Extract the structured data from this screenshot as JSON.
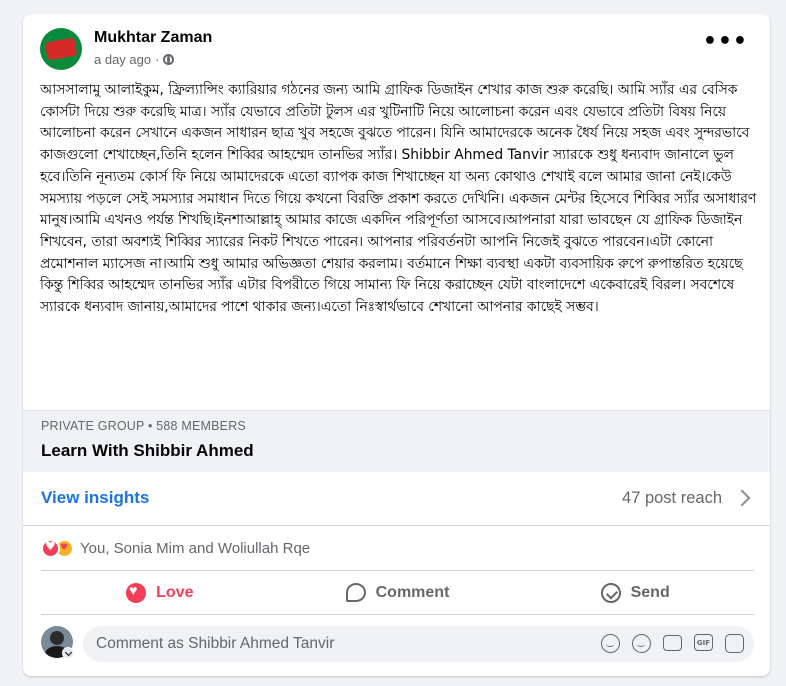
{
  "post": {
    "author": "Mukhtar Zaman",
    "time": "a day ago",
    "more_label": "•••",
    "text": "আসসালামু আলাইকুম, ফ্রিল্যান্সিং ক্যারিয়ার গঠনের জন্য আমি গ্রাফিক ডিজাইন শেখার কাজ শুরু করেছি। আমি স্যাঁর এর বেসিক কোর্সটা দিয়ে শুরু করেছি মাত্র। স্যাঁর যেভাবে প্রতিটা টুলস এর খুটিনাটি নিয়ে আলোচনা করেন এবং যেভাবে প্রতিটা বিষয় নিয়ে আলোচনা করেন সেখানে একজন সাধারন ছাত্র খুব সহজে বুঝতে পারেন। যিনি আমাদেরকে অনেক ধৈর্য নিয়ে সহজ এবং সুন্দরভাবে কাজগুলো শেখাচ্ছেন,তিনি হলেন শিব্বির আহম্মেদ তানভির স্যাঁর। Shibbir Ahmed Tanvir স্যারকে শুধু ধন্যবাদ জানালে ভুল হবে।তিনি নূন্যতম কোর্স ফি নিয়ে আমাদেরকে এতো ব্যাপক কাজ শিখাচ্ছেন যা অন্য কোথাও শেখাই বলে আমার জানা নেই।কেউ সমস্যায় পড়লে সেই সমস্যার সমাধান দিতে গিয়ে কখনো বিরক্তি প্রকাশ করতে দেখিনি। একজন মেন্টর হিসেবে শিব্বির স্যাঁর অসাধারণ মানুষ।আমি এখনও পর্যন্ত শিখছি।ইনশাআল্লাহ্ আমার কাজে একদিন পরিপূর্ণতা আসবে।আপনারা যারা ভাবছেন যে গ্রাফিক ডিজাইন শিখবেন, তারা অবশ্যই শিব্বির স্যারের নিকট শিখতে পারেন। আপনার পরিবর্তনটা আপনি নিজেই বুঝতে পারবেন।এটা কোনো প্রমোশনাল ম্যাসেজ না।আমি শুধু আমার অভিজ্ঞতা শেয়ার করলাম। বর্তমানে শিক্ষা ব্যবস্থা একটা ব্যবসায়িক রুপে রুপান্তরিত হয়েছে কিন্তু শিব্বির আহম্মেদ তানভির স্যাঁর এটার বিপরীতে গিয়ে সামান্য ফি নিয়ে করাচ্ছেন যেটা বাংলাদেশে একেবারেই বিরল। সবশেষে স্যারকে ধন্যবাদ জানায়,আমাদের পাশে থাকার জন্য।এতো নিঃস্বার্থভাবে শেখানো আপনার কাছেই সম্ভব।"
  },
  "group": {
    "meta": "PRIVATE GROUP • 588 MEMBERS",
    "name": "Learn With Shibbir Ahmed"
  },
  "insights": {
    "label": "View insights",
    "reach": "47 post reach"
  },
  "reactions": {
    "names": "You, Sonia Mim and Woliullah Rqe"
  },
  "actions": {
    "love": "Love",
    "comment": "Comment",
    "send": "Send"
  },
  "composer": {
    "placeholder": "Comment as Shibbir Ahmed Tanvir",
    "gif_label": "GIF"
  },
  "colors": {
    "link_blue": "#1b74e4",
    "love_red": "#f33e58",
    "muted_gray": "#65676b"
  }
}
